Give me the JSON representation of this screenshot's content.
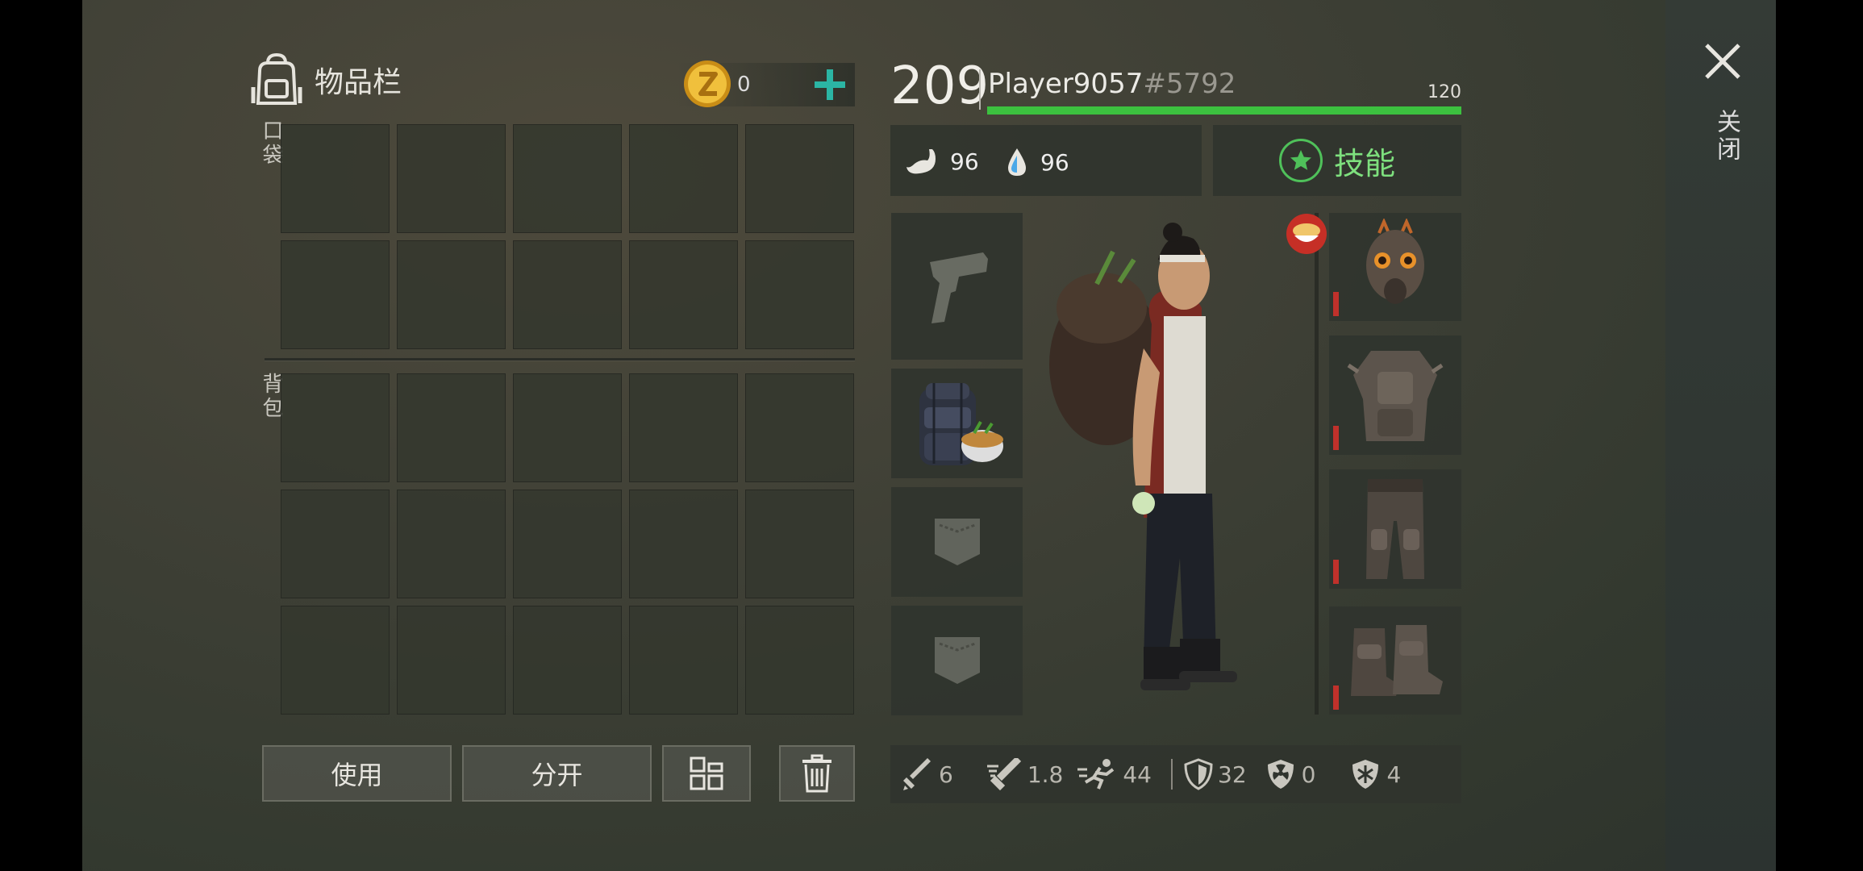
{
  "inventory": {
    "title": "物品栏",
    "pocket_label": "口袋",
    "backpack_label": "背包",
    "coins": "0",
    "buttons": {
      "use": "使用",
      "split": "分开"
    }
  },
  "player": {
    "level": "209",
    "name": "Player9057",
    "tag": "#5792",
    "xp_value": "120",
    "xp_fraction": 1.0
  },
  "status": {
    "food": "96",
    "water": "96"
  },
  "skills": {
    "label": "技能"
  },
  "combat_stats": {
    "damage": "6",
    "attack_speed": "1.8",
    "move_speed": "44",
    "armor": "32",
    "radiation": "0",
    "cold": "4"
  },
  "close": {
    "label": "关闭"
  },
  "icons": [
    "backpack-icon",
    "coin-icon",
    "plus-icon",
    "stomach-icon",
    "water-drop-icon",
    "star-icon",
    "pistol-icon",
    "pocket-icon",
    "noodle-bowl-icon",
    "trash-icon",
    "sort-grid-icon",
    "close-icon",
    "sword-icon",
    "shield-icon",
    "radiation-icon",
    "snowflake-icon",
    "running-icon"
  ],
  "colors": {
    "xp": "#3cc13f",
    "skills": "#7ee07e",
    "plus": "#2bb5a4",
    "durability": "#c0312b",
    "coin": "#e8b330"
  }
}
